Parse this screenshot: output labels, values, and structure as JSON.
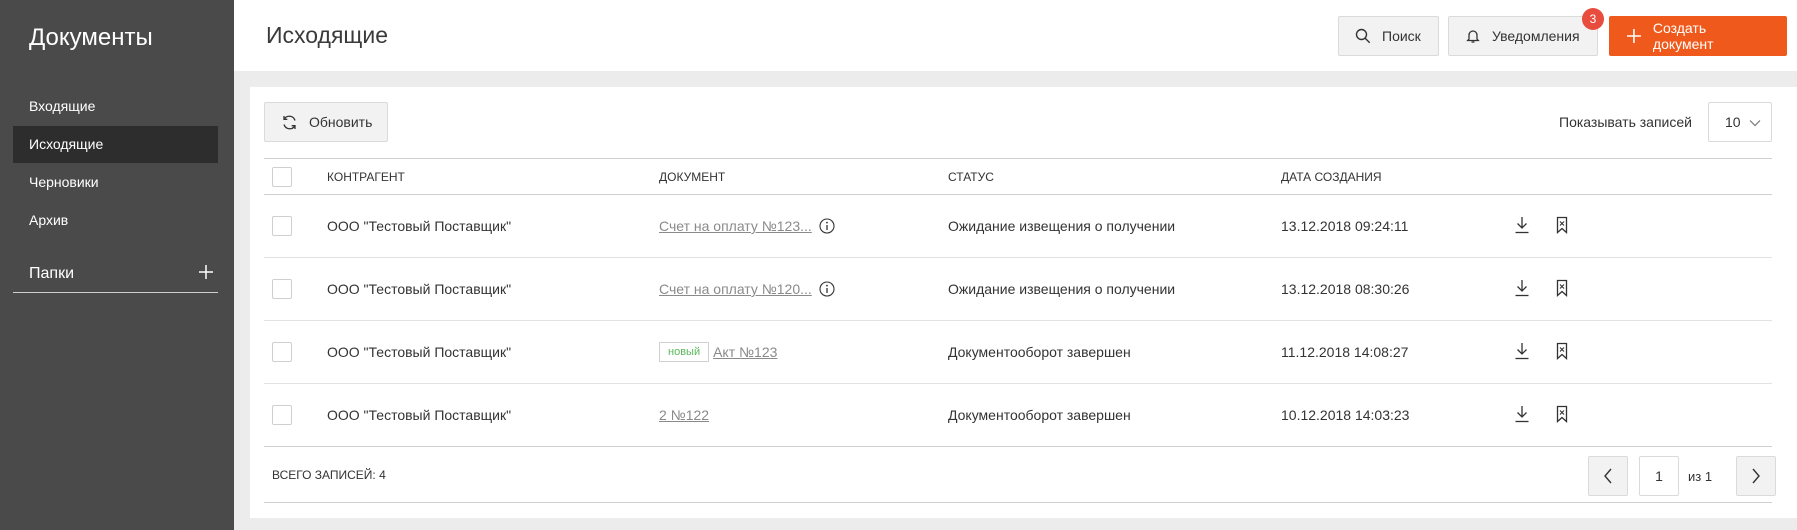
{
  "sidebar": {
    "title": "Документы",
    "items": [
      {
        "label": "Входящие"
      },
      {
        "label": "Исходящие"
      },
      {
        "label": "Черновики"
      },
      {
        "label": "Архив"
      }
    ],
    "folders_label": "Папки"
  },
  "header": {
    "title": "Исходящие",
    "search_label": "Поиск",
    "notifications_label": "Уведомления",
    "notifications_count": "3",
    "create_label": "Создать документ"
  },
  "toolbar": {
    "refresh_label": "Обновить",
    "show_records_label": "Показывать записей",
    "page_size": "10"
  },
  "table": {
    "columns": [
      "КОНТРАГЕНТ",
      "ДОКУМЕНТ",
      "СТАТУС",
      "ДАТА СОЗДАНИЯ"
    ],
    "rows": [
      {
        "contractor": "ООО \"Тестовый Поставщик\"",
        "document": "Счет на оплату №123...",
        "badge": "",
        "status": "Ожидание извещения о получении",
        "date": "13.12.2018 09:24:11"
      },
      {
        "contractor": "ООО \"Тестовый Поставщик\"",
        "document": "Счет на оплату №120...",
        "badge": "",
        "status": "Ожидание извещения о получении",
        "date": "13.12.2018 08:30:26"
      },
      {
        "contractor": "ООО \"Тестовый Поставщик\"",
        "document": "Акт №123",
        "badge": "новый",
        "status": "Документооборот завершен",
        "date": "11.12.2018 14:08:27"
      },
      {
        "contractor": "ООО \"Тестовый Поставщик\"",
        "document": "2 №122",
        "badge": "",
        "status": "Документооборот завершен",
        "date": "10.12.2018 14:03:23"
      }
    ]
  },
  "footer": {
    "total_label": "ВСЕГО ЗАПИСЕЙ: 4",
    "current_page": "1",
    "of_pages": "из 1"
  },
  "colors": {
    "sidebar_bg": "#4a4a4a",
    "sidebar_active": "#2d2d2d",
    "accent": "#ef5a1c",
    "badge": "#e74c3c",
    "new_badge": "#5cb85c"
  }
}
